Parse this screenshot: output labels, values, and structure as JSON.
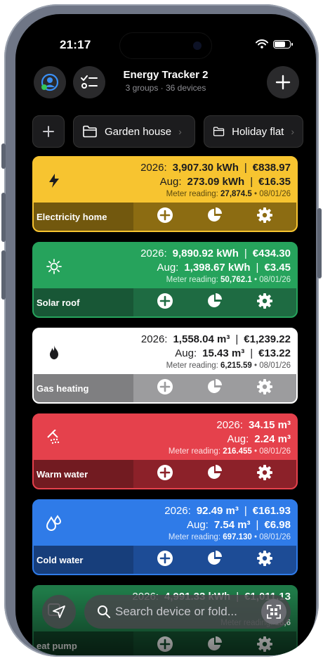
{
  "status_bar": {
    "time": "21:17"
  },
  "header": {
    "title": "Energy Tracker 2",
    "subtitle": "3 groups · 36 devices"
  },
  "folders": [
    {
      "label": "Garden house",
      "icon": "folder-icon"
    },
    {
      "label": "Holiday flat",
      "icon": "folder-icon"
    }
  ],
  "cards": [
    {
      "name": "Electricity home",
      "icon": "lightning-icon",
      "year_label": "2026:",
      "year_value": "3,907.30 kWh",
      "year_cost": "€838.97",
      "month_label": "Aug:",
      "month_value": "273.09 kWh",
      "month_cost": "€16.35",
      "meter_label": "Meter reading:",
      "meter_value": "27,874.5",
      "meter_date": "• 08/01/26",
      "colors": {
        "top": "#f7c430",
        "bottom": "#8c6c12",
        "border": "#f7c430",
        "text": "#1c1c1e",
        "muted": "#5c4a10"
      }
    },
    {
      "name": "Solar roof",
      "icon": "sun-icon",
      "year_label": "2026:",
      "year_value": "9,890.92 kWh",
      "year_cost": "€434.30",
      "month_label": "Aug:",
      "month_value": "1,398.67 kWh",
      "month_cost": "€3.45",
      "meter_label": "Meter reading:",
      "meter_value": "50,762.1",
      "meter_date": "• 08/01/26",
      "colors": {
        "top": "#26a35c",
        "bottom": "#1e6b42",
        "border": "#26a35c",
        "text": "#ffffff",
        "muted": "#d6f0e0"
      }
    },
    {
      "name": "Gas heating",
      "icon": "flame-icon",
      "year_label": "2026:",
      "year_value": "1,558.04 m³",
      "year_cost": "€1,239.22",
      "month_label": "Aug:",
      "month_value": "15.43 m³",
      "month_cost": "€13.22",
      "meter_label": "Meter reading:",
      "meter_value": "6,215.59",
      "meter_date": "• 08/01/26",
      "colors": {
        "top": "#ffffff",
        "bottom": "#9c9c9e",
        "border": "#ffffff",
        "text": "#1c1c1e",
        "muted": "#555557"
      }
    },
    {
      "name": "Warm water",
      "icon": "shower-icon",
      "year_label": "2026:",
      "year_value": "34.15 m³",
      "year_cost": "",
      "month_label": "Aug:",
      "month_value": "2.24 m³",
      "month_cost": "",
      "meter_label": "Meter reading:",
      "meter_value": "216.455",
      "meter_date": "• 08/01/26",
      "colors": {
        "top": "#e5414c",
        "bottom": "#8c2129",
        "border": "#e5414c",
        "text": "#ffffff",
        "muted": "#fde0e2"
      }
    },
    {
      "name": "Cold water",
      "icon": "water-drops-icon",
      "year_label": "2026:",
      "year_value": "92.49 m³",
      "year_cost": "€161.93",
      "month_label": "Aug:",
      "month_value": "7.54 m³",
      "month_cost": "€6.98",
      "meter_label": "Meter reading:",
      "meter_value": "697.130",
      "meter_date": "• 08/01/26",
      "colors": {
        "top": "#2f7be8",
        "bottom": "#1d4c96",
        "border": "#2f7be8",
        "text": "#ffffff",
        "muted": "#dce9fc"
      }
    },
    {
      "name": "eat pump",
      "icon": "heat-pump-icon",
      "year_label": "2026:",
      "year_value": "4,991.33 kWh",
      "year_cost": "€1,011.13",
      "month_label": "",
      "month_value": "",
      "month_cost": "",
      "meter_label": "Meter reading:",
      "meter_value": "18,6",
      "meter_date": "",
      "colors": {
        "top": "#1f7a48",
        "bottom": "#14502f",
        "border": "#1f7a48",
        "text": "#ffffff",
        "muted": "#cfe9da"
      }
    }
  ],
  "search": {
    "placeholder": "Search device or fold..."
  },
  "actions": [
    "add-reading-icon",
    "statistics-pie-icon",
    "settings-gear-icon"
  ]
}
